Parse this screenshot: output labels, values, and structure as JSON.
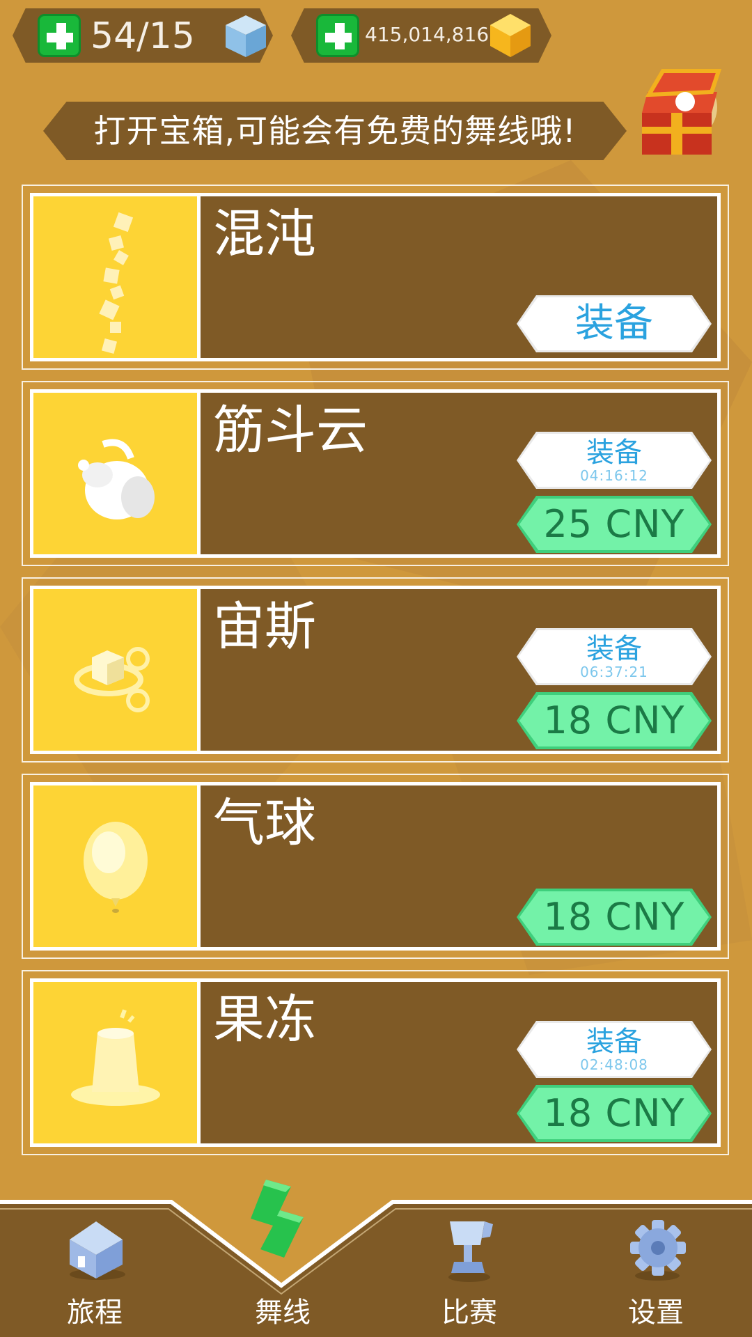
{
  "header": {
    "energy": {
      "value": "54/15",
      "add_icon": "plus-icon",
      "resource_icon": "blue-cube-icon"
    },
    "gems": {
      "value": "415,014,816",
      "add_icon": "plus-icon",
      "resource_icon": "gold-gem-icon"
    }
  },
  "banner": {
    "text": "打开宝箱,可能会有免费的舞线哦!",
    "chest_icon": "treasure-chest-icon"
  },
  "items": [
    {
      "title": "混沌",
      "equip_label": "装备",
      "timer": "",
      "price": ""
    },
    {
      "title": "筋斗云",
      "equip_label": "装备",
      "timer": "04:16:12",
      "price": "25 CNY"
    },
    {
      "title": "宙斯",
      "equip_label": "装备",
      "timer": "06:37:21",
      "price": "18 CNY"
    },
    {
      "title": "气球",
      "equip_label": "",
      "timer": "",
      "price": "18 CNY"
    },
    {
      "title": "果冻",
      "equip_label": "装备",
      "timer": "02:48:08",
      "price": "18 CNY"
    }
  ],
  "nav": {
    "tabs": [
      {
        "label": "旅程",
        "icon": "house-icon"
      },
      {
        "label": "舞线",
        "icon": "dance-line-icon"
      },
      {
        "label": "比赛",
        "icon": "trophy-icon"
      },
      {
        "label": "设置",
        "icon": "gear-icon"
      }
    ]
  },
  "colors": {
    "background": "#cf983c",
    "panel": "#7f5a26",
    "thumb": "#fdd435",
    "price_button": "#73f2a8",
    "equip_text": "#2aa2df"
  }
}
